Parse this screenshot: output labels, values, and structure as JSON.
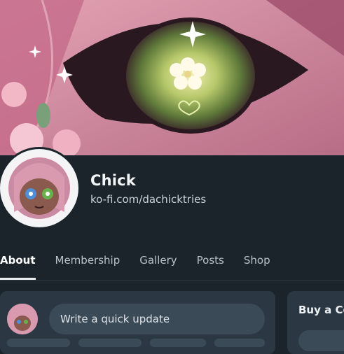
{
  "profile": {
    "name": "Chick",
    "url": "ko-fi.com/dachicktries"
  },
  "tabs": [
    {
      "label": "About",
      "active": true
    },
    {
      "label": "Membership",
      "active": false
    },
    {
      "label": "Gallery",
      "active": false
    },
    {
      "label": "Posts",
      "active": false
    },
    {
      "label": "Shop",
      "active": false
    }
  ],
  "feed": {
    "quick_update_placeholder": "Write a quick update"
  },
  "sidebar": {
    "title": "Buy a Co"
  },
  "colors": {
    "background": "#1c242b",
    "card": "#2b3843",
    "input": "#3a4a57",
    "banner_pink": "#d98fa6"
  }
}
